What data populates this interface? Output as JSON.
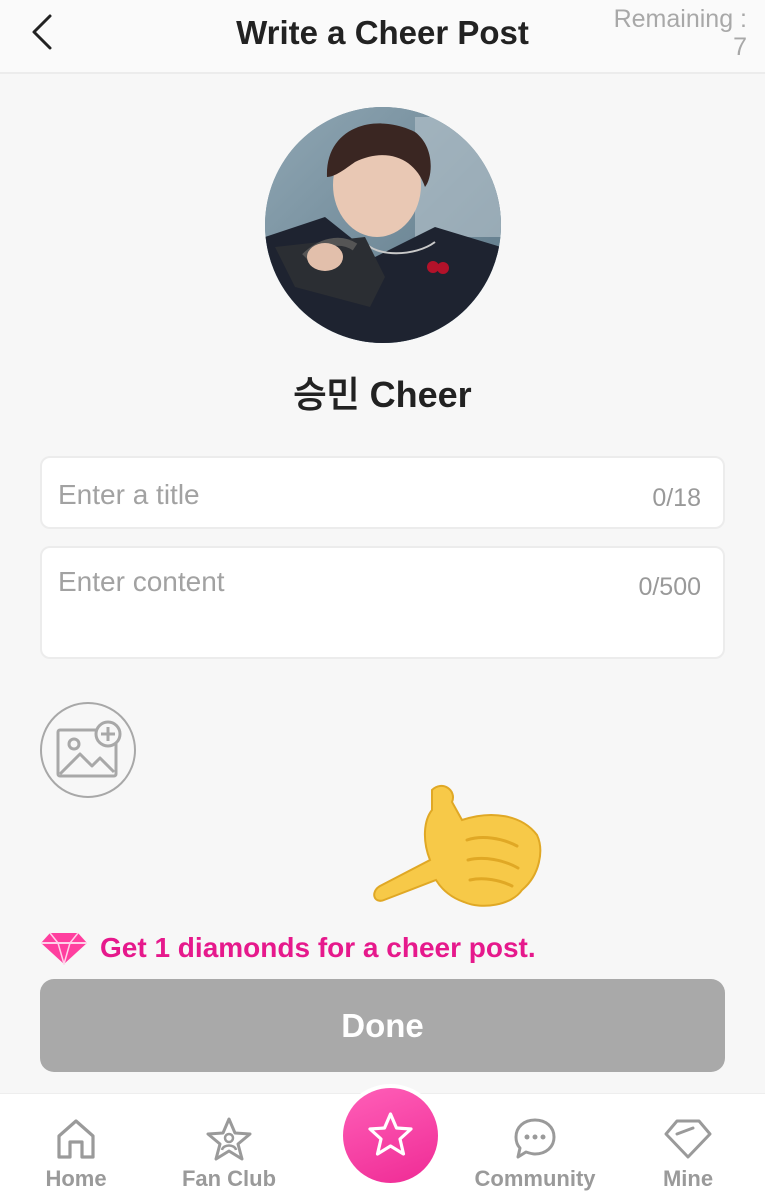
{
  "header": {
    "title": "Write a Cheer Post",
    "remaining_label": "Remaining :",
    "remaining_count": "7"
  },
  "profile": {
    "cheer_title": "승민 Cheer"
  },
  "form": {
    "title_placeholder": "Enter a title",
    "title_counter": "0/18",
    "content_placeholder": "Enter content",
    "content_counter": "0/500"
  },
  "reward": {
    "text": "Get 1 diamonds for a cheer post."
  },
  "done_label": "Done",
  "nav": {
    "items": [
      {
        "label": "Home",
        "icon": "home-icon"
      },
      {
        "label": "Fan Club",
        "icon": "fan-club-icon"
      },
      {
        "label": "",
        "icon": "star-icon"
      },
      {
        "label": "Community",
        "icon": "chat-icon"
      },
      {
        "label": "Mine",
        "icon": "tag-icon"
      }
    ]
  },
  "colors": {
    "accent": "#e6198c",
    "button_disabled": "#a9a9a9",
    "nav_inactive": "#9a9a9a"
  }
}
